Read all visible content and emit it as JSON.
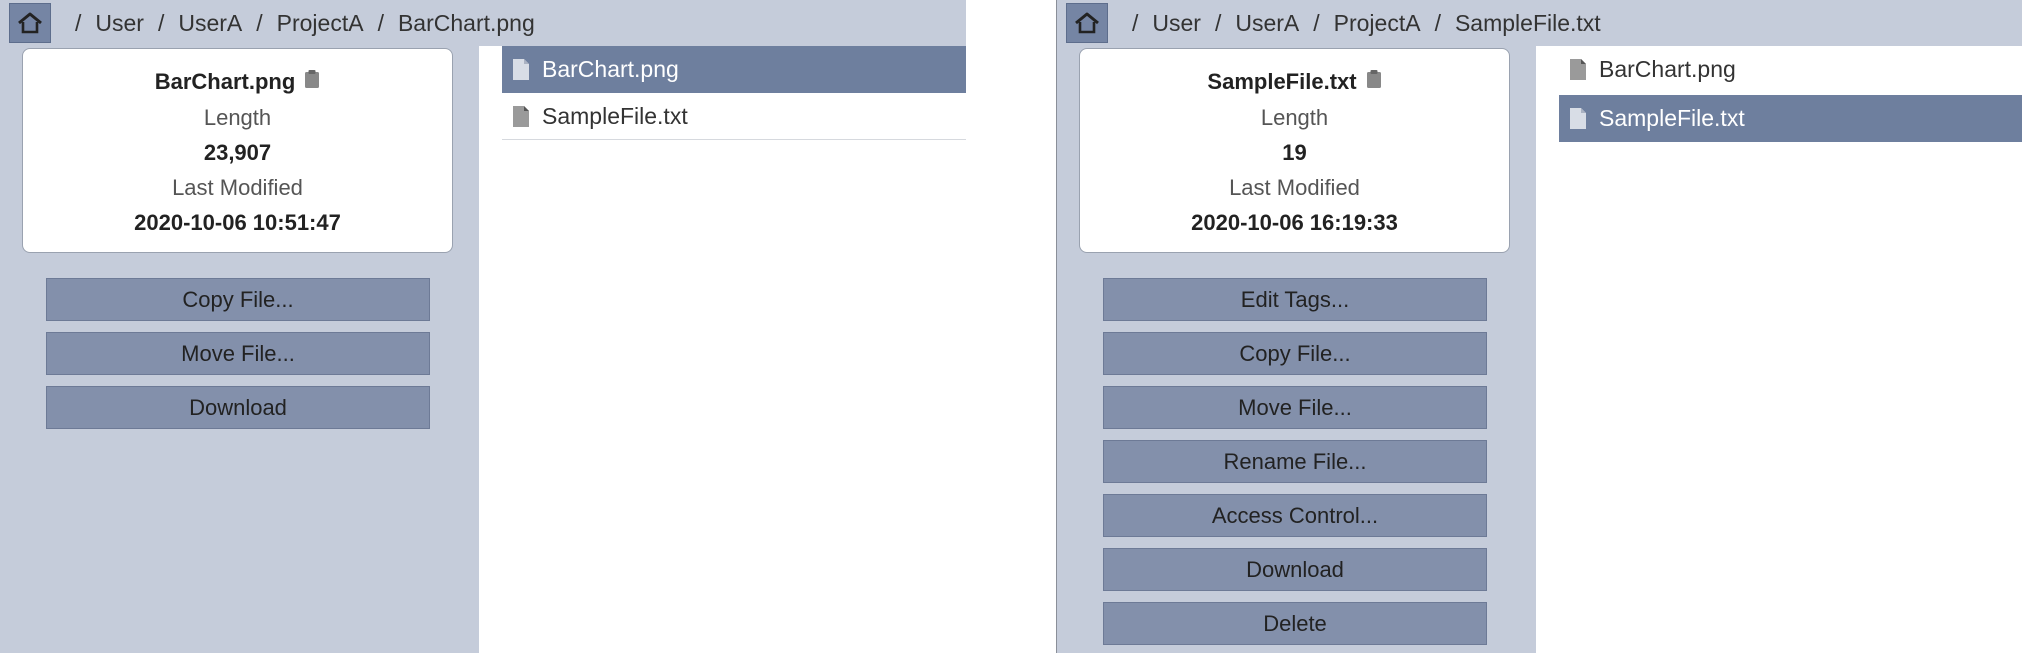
{
  "left": {
    "breadcrumb": [
      "User",
      "UserA",
      "ProjectA",
      "BarChart.png"
    ],
    "info": {
      "name": "BarChart.png",
      "length_label": "Length",
      "length_value": "23,907",
      "modified_label": "Last Modified",
      "modified_value": "2020-10-06 10:51:47"
    },
    "actions": [
      "Copy File...",
      "Move File...",
      "Download"
    ],
    "files": [
      "BarChart.png",
      "SampleFile.txt"
    ],
    "selected_file": "BarChart.png"
  },
  "right": {
    "breadcrumb": [
      "User",
      "UserA",
      "ProjectA",
      "SampleFile.txt"
    ],
    "info": {
      "name": "SampleFile.txt",
      "length_label": "Length",
      "length_value": "19",
      "modified_label": "Last Modified",
      "modified_value": "2020-10-06 16:19:33"
    },
    "actions": [
      "Edit Tags...",
      "Copy File...",
      "Move File...",
      "Rename File...",
      "Access Control...",
      "Download",
      "Delete"
    ],
    "files": [
      "BarChart.png",
      "SampleFile.txt"
    ],
    "selected_file": "SampleFile.txt"
  },
  "icons": {
    "home": "home-icon",
    "clipboard": "clipboard-icon",
    "file": "file-icon"
  },
  "colors": {
    "bar_bg": "#c5ccda",
    "button_bg": "#8390ab",
    "selected_bg": "#6e7f9e",
    "home_bg": "#7585a4"
  }
}
